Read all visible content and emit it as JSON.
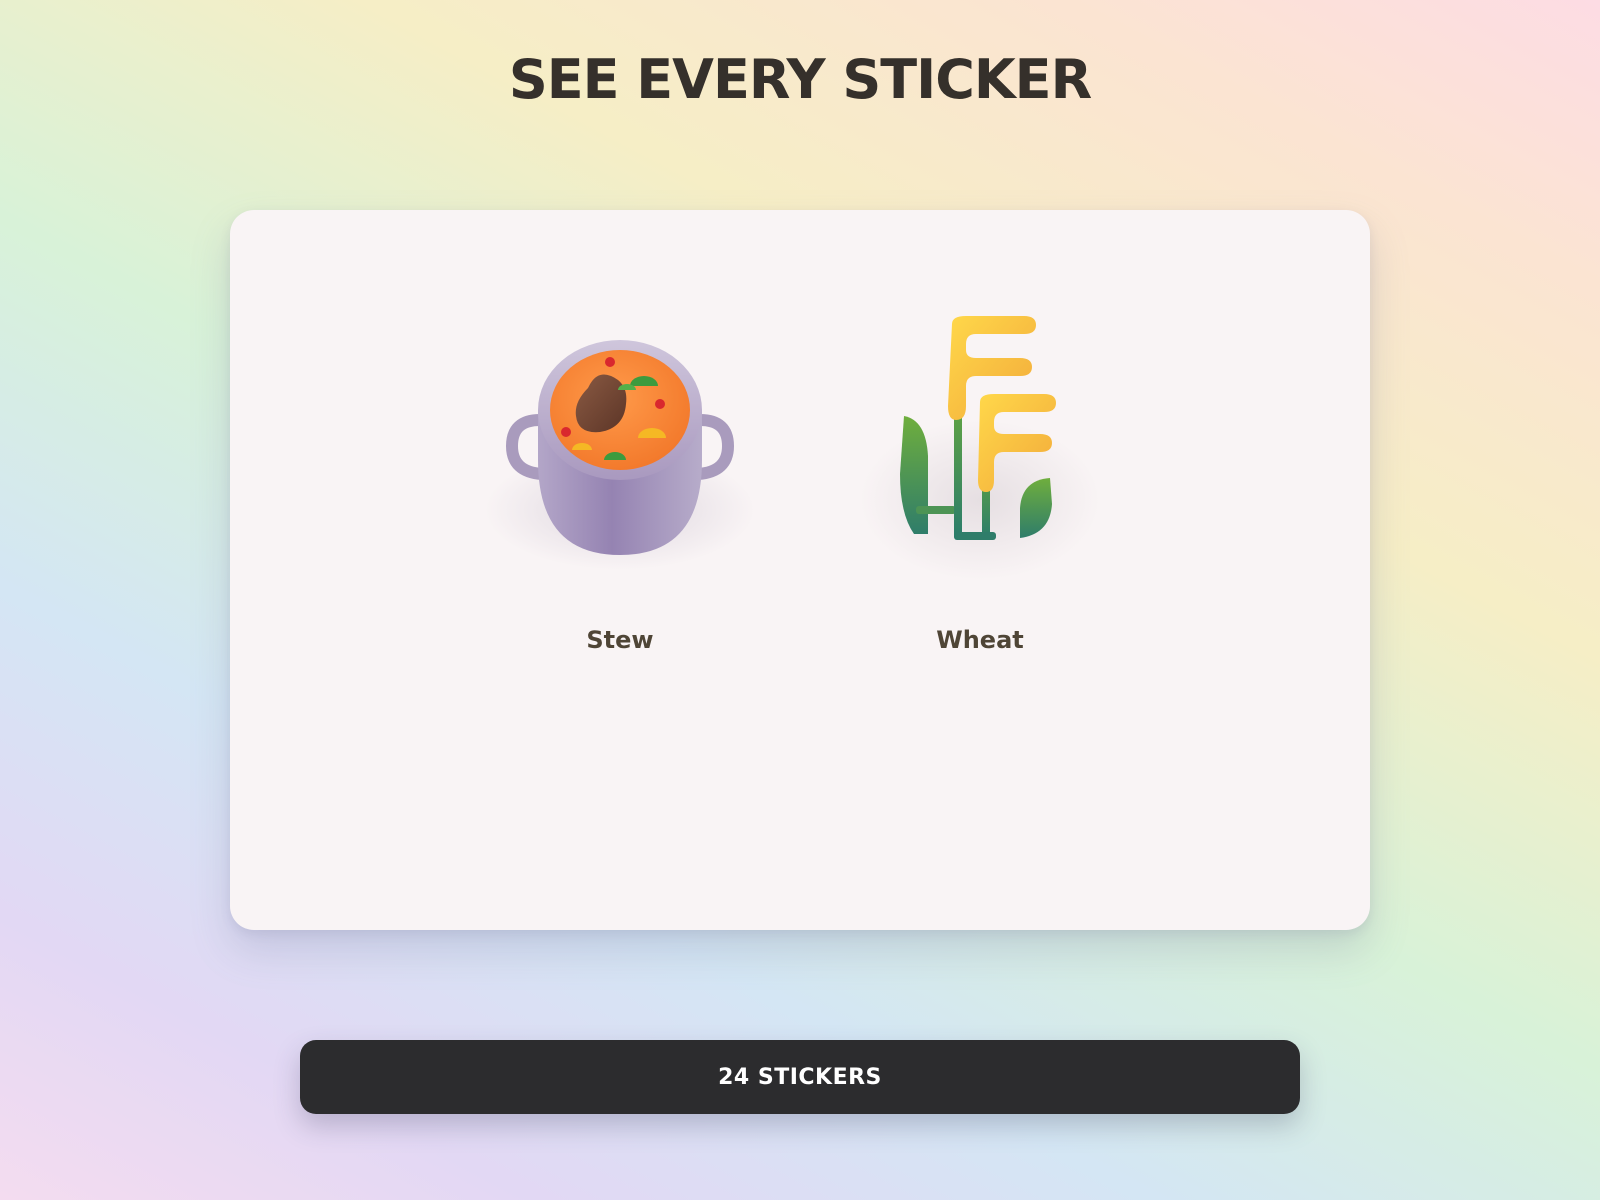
{
  "page": {
    "title": "SEE EVERY STICKER"
  },
  "stickers": [
    {
      "name": "Stew",
      "icon": "stew-pot-icon"
    },
    {
      "name": "Wheat",
      "icon": "wheat-icon"
    }
  ],
  "footer": {
    "count_label": "24 STICKERS"
  },
  "colors": {
    "title_text": "#35302b",
    "card_bg": "#f9f4f5",
    "label_text": "#4f4536",
    "button_bg": "#2c2c2e",
    "button_text": "#ffffff"
  }
}
